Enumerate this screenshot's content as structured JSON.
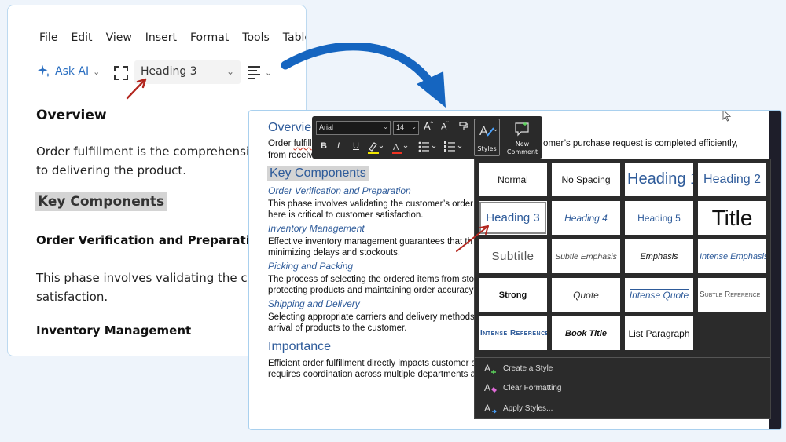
{
  "menu": [
    "File",
    "Edit",
    "View",
    "Insert",
    "Format",
    "Tools",
    "Table"
  ],
  "toolbar": {
    "ask_ai": "Ask AI",
    "style_value": "Heading 3"
  },
  "left_doc": {
    "overview": "Overview",
    "p1_line1": "Order fulfillment is the comprehensiv",
    "p1_line2": "to delivering the product.",
    "key_components": "Key Components",
    "h_order": "Order Verification and Preparation",
    "p2_line1": "This phase involves validating the cus",
    "p2_line2": "satisfaction.",
    "h_inventory": "Inventory Management"
  },
  "right_doc": {
    "overview": "Overvie",
    "ov_line1_a": "Order ",
    "ov_line1_b": "fulfill",
    "ov_line1_c": "omer’s purchase request is completed efficiently,",
    "ov_line2": "from receiv",
    "key_components": "Key Components",
    "h_order_a": "Order ",
    "h_order_b": "Verification",
    "h_order_c": " and ",
    "h_order_d": "Preparation",
    "order_l1": "This phase involves validating the customer’s order",
    "order_l2": "here is critical to customer satisfaction.",
    "h_inventory": "Inventory Management",
    "inv_l1": "Effective inventory management guarantees that th",
    "inv_l2": "minimizing delays and stockouts.",
    "h_picking": "Picking and Packing",
    "pick_l1": "The process of selecting the ordered items from sto",
    "pick_l2": "protecting products and maintaining order accuracy",
    "h_shipping": "Shipping and Delivery",
    "ship_l1": "Selecting appropriate carriers and delivery methods",
    "ship_l2": "arrival of products to the customer.",
    "importance": "Importance",
    "imp_l1": "Efficient order fulfillment directly impacts customer s",
    "imp_l2": "requires coordination across multiple departments a"
  },
  "mini_toolbar": {
    "font": "Arial",
    "size": "14",
    "bold": "B",
    "italic": "I",
    "underline": "U",
    "styles_label": "Styles",
    "new_comment_line1": "New",
    "new_comment_line2": "Comment"
  },
  "styles_gallery": {
    "tiles": [
      "Normal",
      "No Spacing",
      "Heading 1",
      "Heading 2",
      "Heading 3",
      "Heading 4",
      "Heading 5",
      "Title",
      "Subtitle",
      "Subtle Emphasis",
      "Emphasis",
      "Intense Emphasis",
      "Strong",
      "Quote",
      "Intense Quote",
      "Subtle Reference",
      "Intense Reference",
      "Book Title",
      "List Paragraph"
    ],
    "create_style": "Create a Style",
    "clear_formatting": "Clear Formatting",
    "apply_styles": "Apply Styles..."
  },
  "colors": {
    "accent_blue": "#2b6fc1",
    "heading_blue": "#2e5b9a",
    "arrow_blue": "#1565c0",
    "annotation_red": "#b3261e"
  }
}
